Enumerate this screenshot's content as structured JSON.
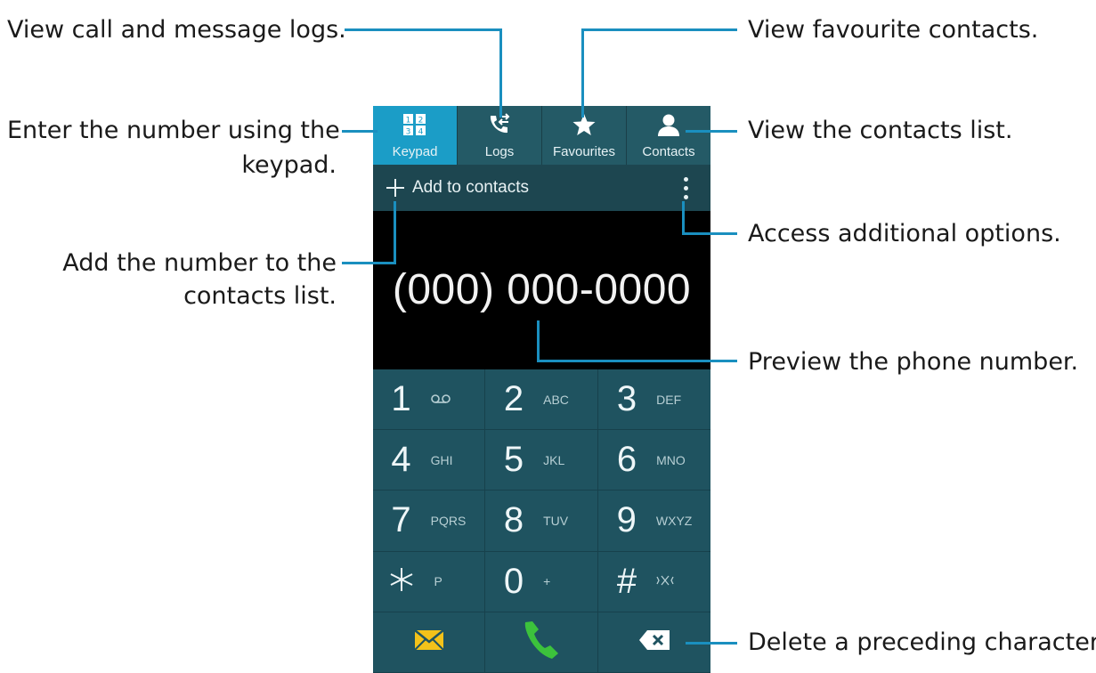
{
  "annotations": {
    "logs": "View call and message logs.",
    "favourites": "View favourite contacts.",
    "keypad_line1": "Enter the number using the",
    "keypad_line2": "keypad.",
    "contacts": "View the contacts list.",
    "options": "Access additional options.",
    "add_line1": "Add the number to the",
    "add_line2": "contacts list.",
    "preview": "Preview the phone number.",
    "delete": "Delete a preceding character."
  },
  "tabs": [
    {
      "label": "Keypad",
      "icon": "keypad-icon",
      "active": true
    },
    {
      "label": "Logs",
      "icon": "logs-icon"
    },
    {
      "label": "Favourites",
      "icon": "star-icon"
    },
    {
      "label": "Contacts",
      "icon": "person-icon"
    }
  ],
  "toolbar": {
    "add_label": "Add to contacts"
  },
  "display": {
    "number": "(000) 000-0000"
  },
  "keys": [
    {
      "digit": "1",
      "letters": "ꝏ"
    },
    {
      "digit": "2",
      "letters": "ABC"
    },
    {
      "digit": "3",
      "letters": "DEF"
    },
    {
      "digit": "4",
      "letters": "GHI"
    },
    {
      "digit": "5",
      "letters": "JKL"
    },
    {
      "digit": "6",
      "letters": "MNO"
    },
    {
      "digit": "7",
      "letters": "PQRS"
    },
    {
      "digit": "8",
      "letters": "TUV"
    },
    {
      "digit": "9",
      "letters": "WXYZ"
    },
    {
      "digit": "✳",
      "letters": "P"
    },
    {
      "digit": "0",
      "letters": "+"
    },
    {
      "digit": "#",
      "letters": "⧖"
    }
  ],
  "colors": {
    "tab_active": "#1b9dc7",
    "tab_bg": "#245a66",
    "key_bg": "#1f5360",
    "call_green": "#3cc23c",
    "message_yellow": "#f3c21a",
    "leader_line": "#1a8fbf"
  }
}
